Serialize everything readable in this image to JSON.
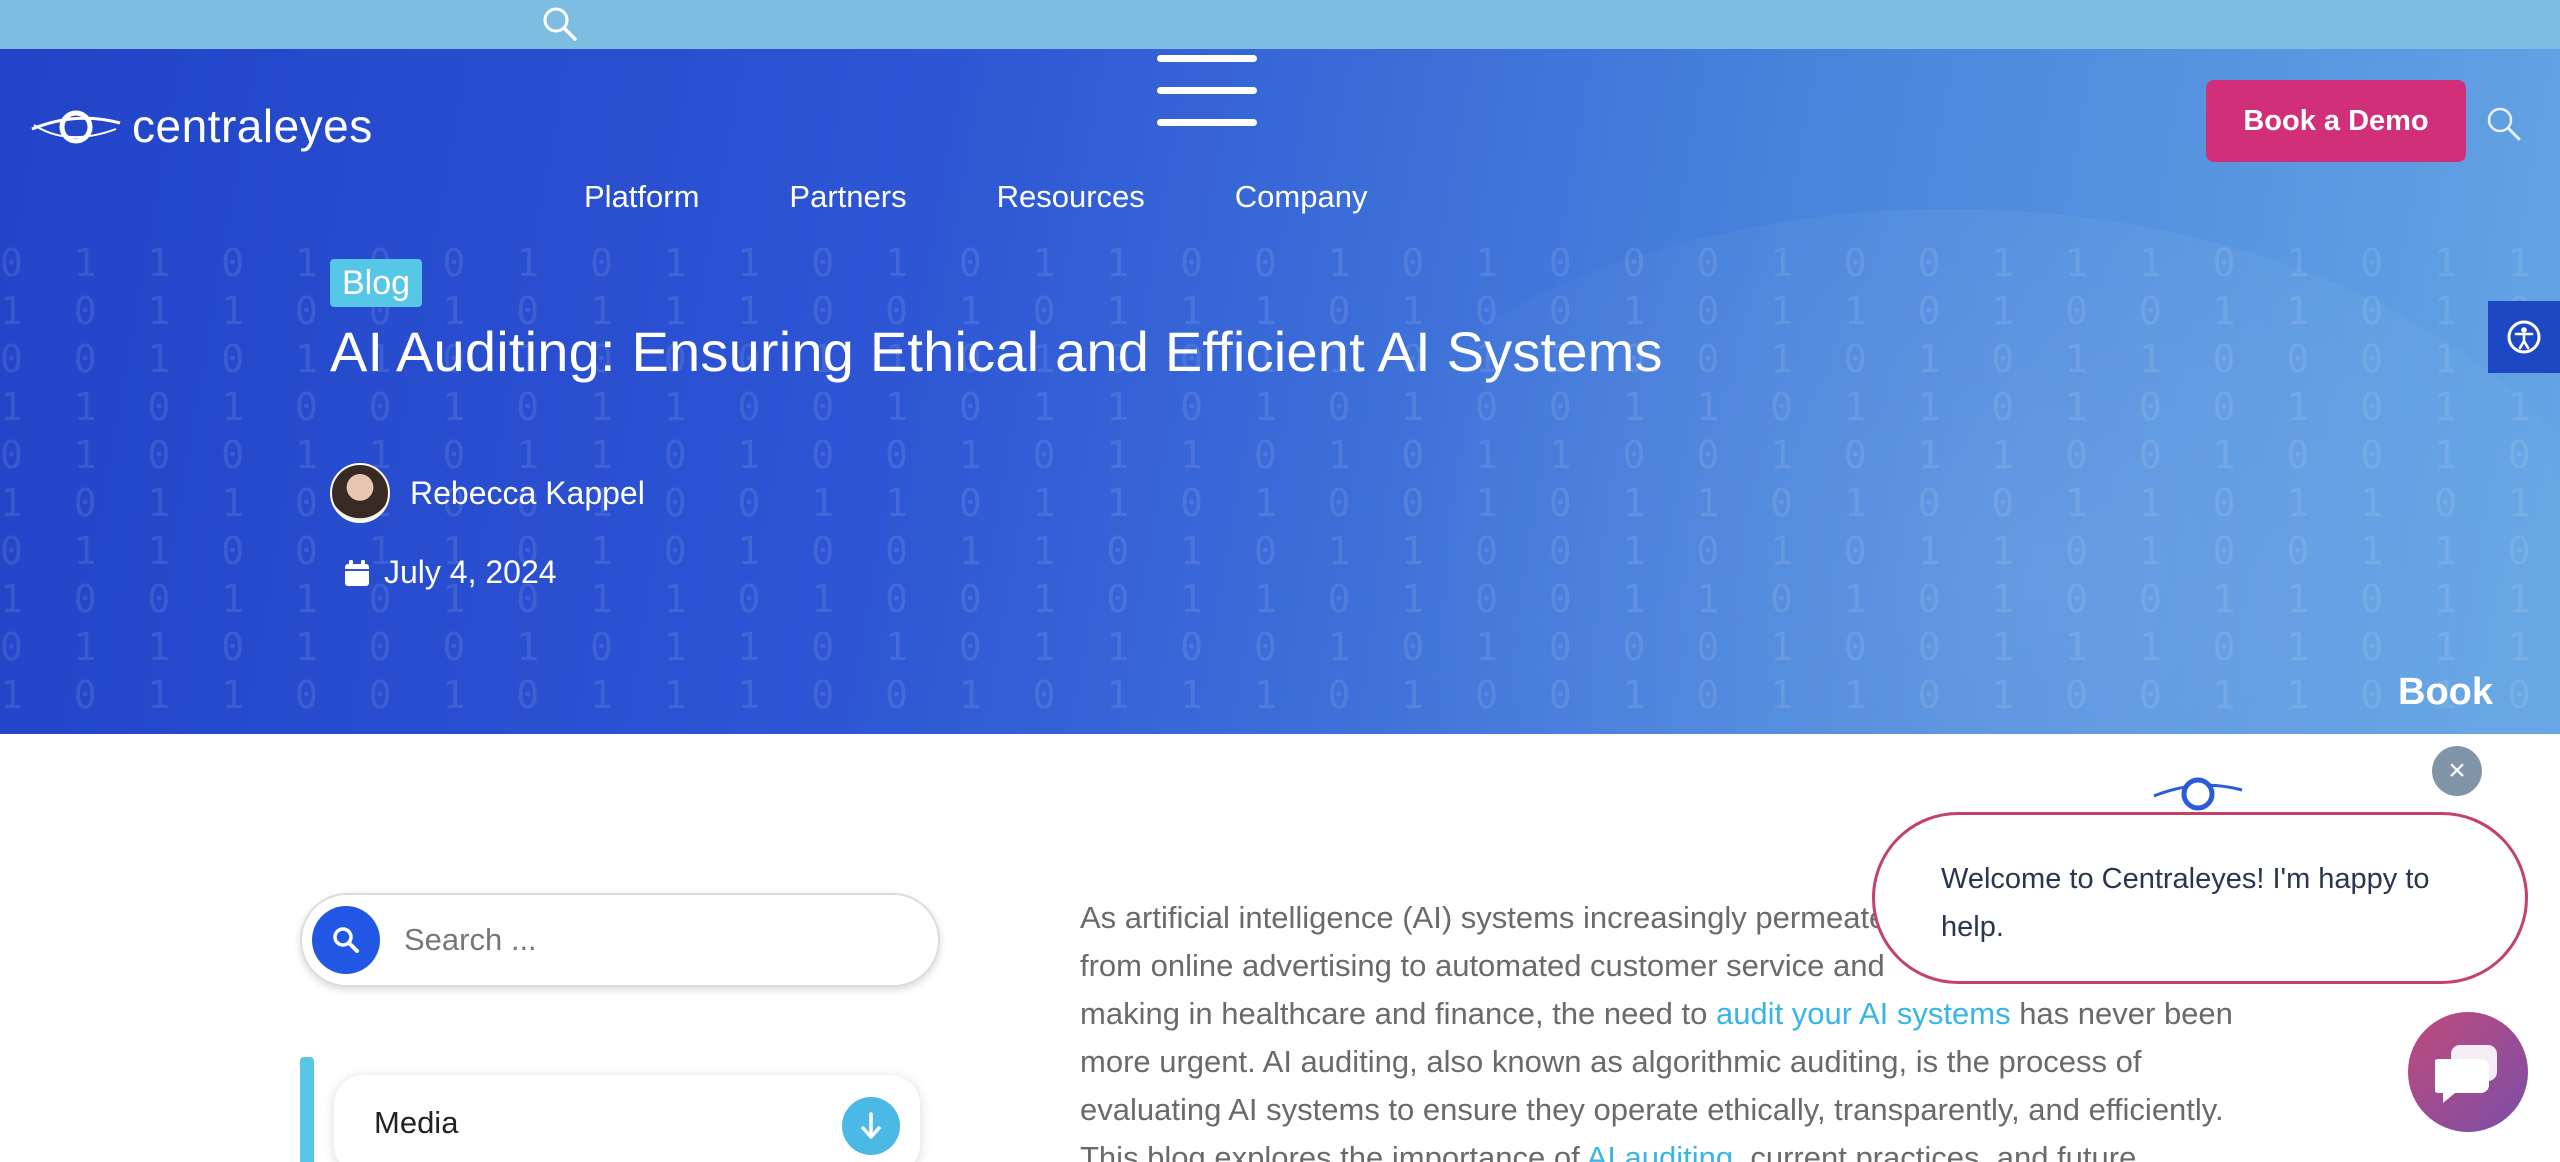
{
  "header": {
    "logo_text": "centraleyes",
    "nav": [
      "Platform",
      "Partners",
      "Resources",
      "Company"
    ],
    "cta_label": "Book a Demo"
  },
  "hero": {
    "badge": "Blog",
    "title": "AI Auditing: Ensuring Ethical and Efficient AI Systems",
    "author": "Rebecca Kappel",
    "date": "July 4, 2024",
    "side_label": "Book"
  },
  "sidebar": {
    "search_placeholder": "Search ...",
    "category_label": "Media"
  },
  "article": {
    "p1_a": "As artificial intelligence (AI) systems increasingly permeate",
    "p1_b": "from online advertising to automated customer service and",
    "p1_c": "making in healthcare and finance, the need to ",
    "link1": "audit your AI systems",
    "p1_d": " has never been",
    "p1_e": "more urgent. AI auditing, also known as algorithmic auditing, is the process of",
    "p1_f": "evaluating AI systems to ensure they operate ethically, transparently, and efficiently.",
    "p1_g": "This blog explores the importance of ",
    "link2": "AI auditing",
    "p1_h": ", current practices, and future"
  },
  "chat": {
    "message": "Welcome to Centraleyes! I'm happy to help.",
    "close_glyph": "×"
  },
  "icons": {
    "top_search": "search-icon",
    "header_search": "search-icon",
    "accessibility": "accessibility-icon",
    "calendar": "calendar-icon",
    "chat": "chat-icon",
    "arrow": "arrow-down-icon"
  },
  "colors": {
    "hero_start": "#2244c8",
    "hero_end": "#66a6e4",
    "cta": "#d12f7a",
    "accent": "#57c7e8",
    "link": "#38b5e6",
    "chat_border": "#c3426c"
  }
}
